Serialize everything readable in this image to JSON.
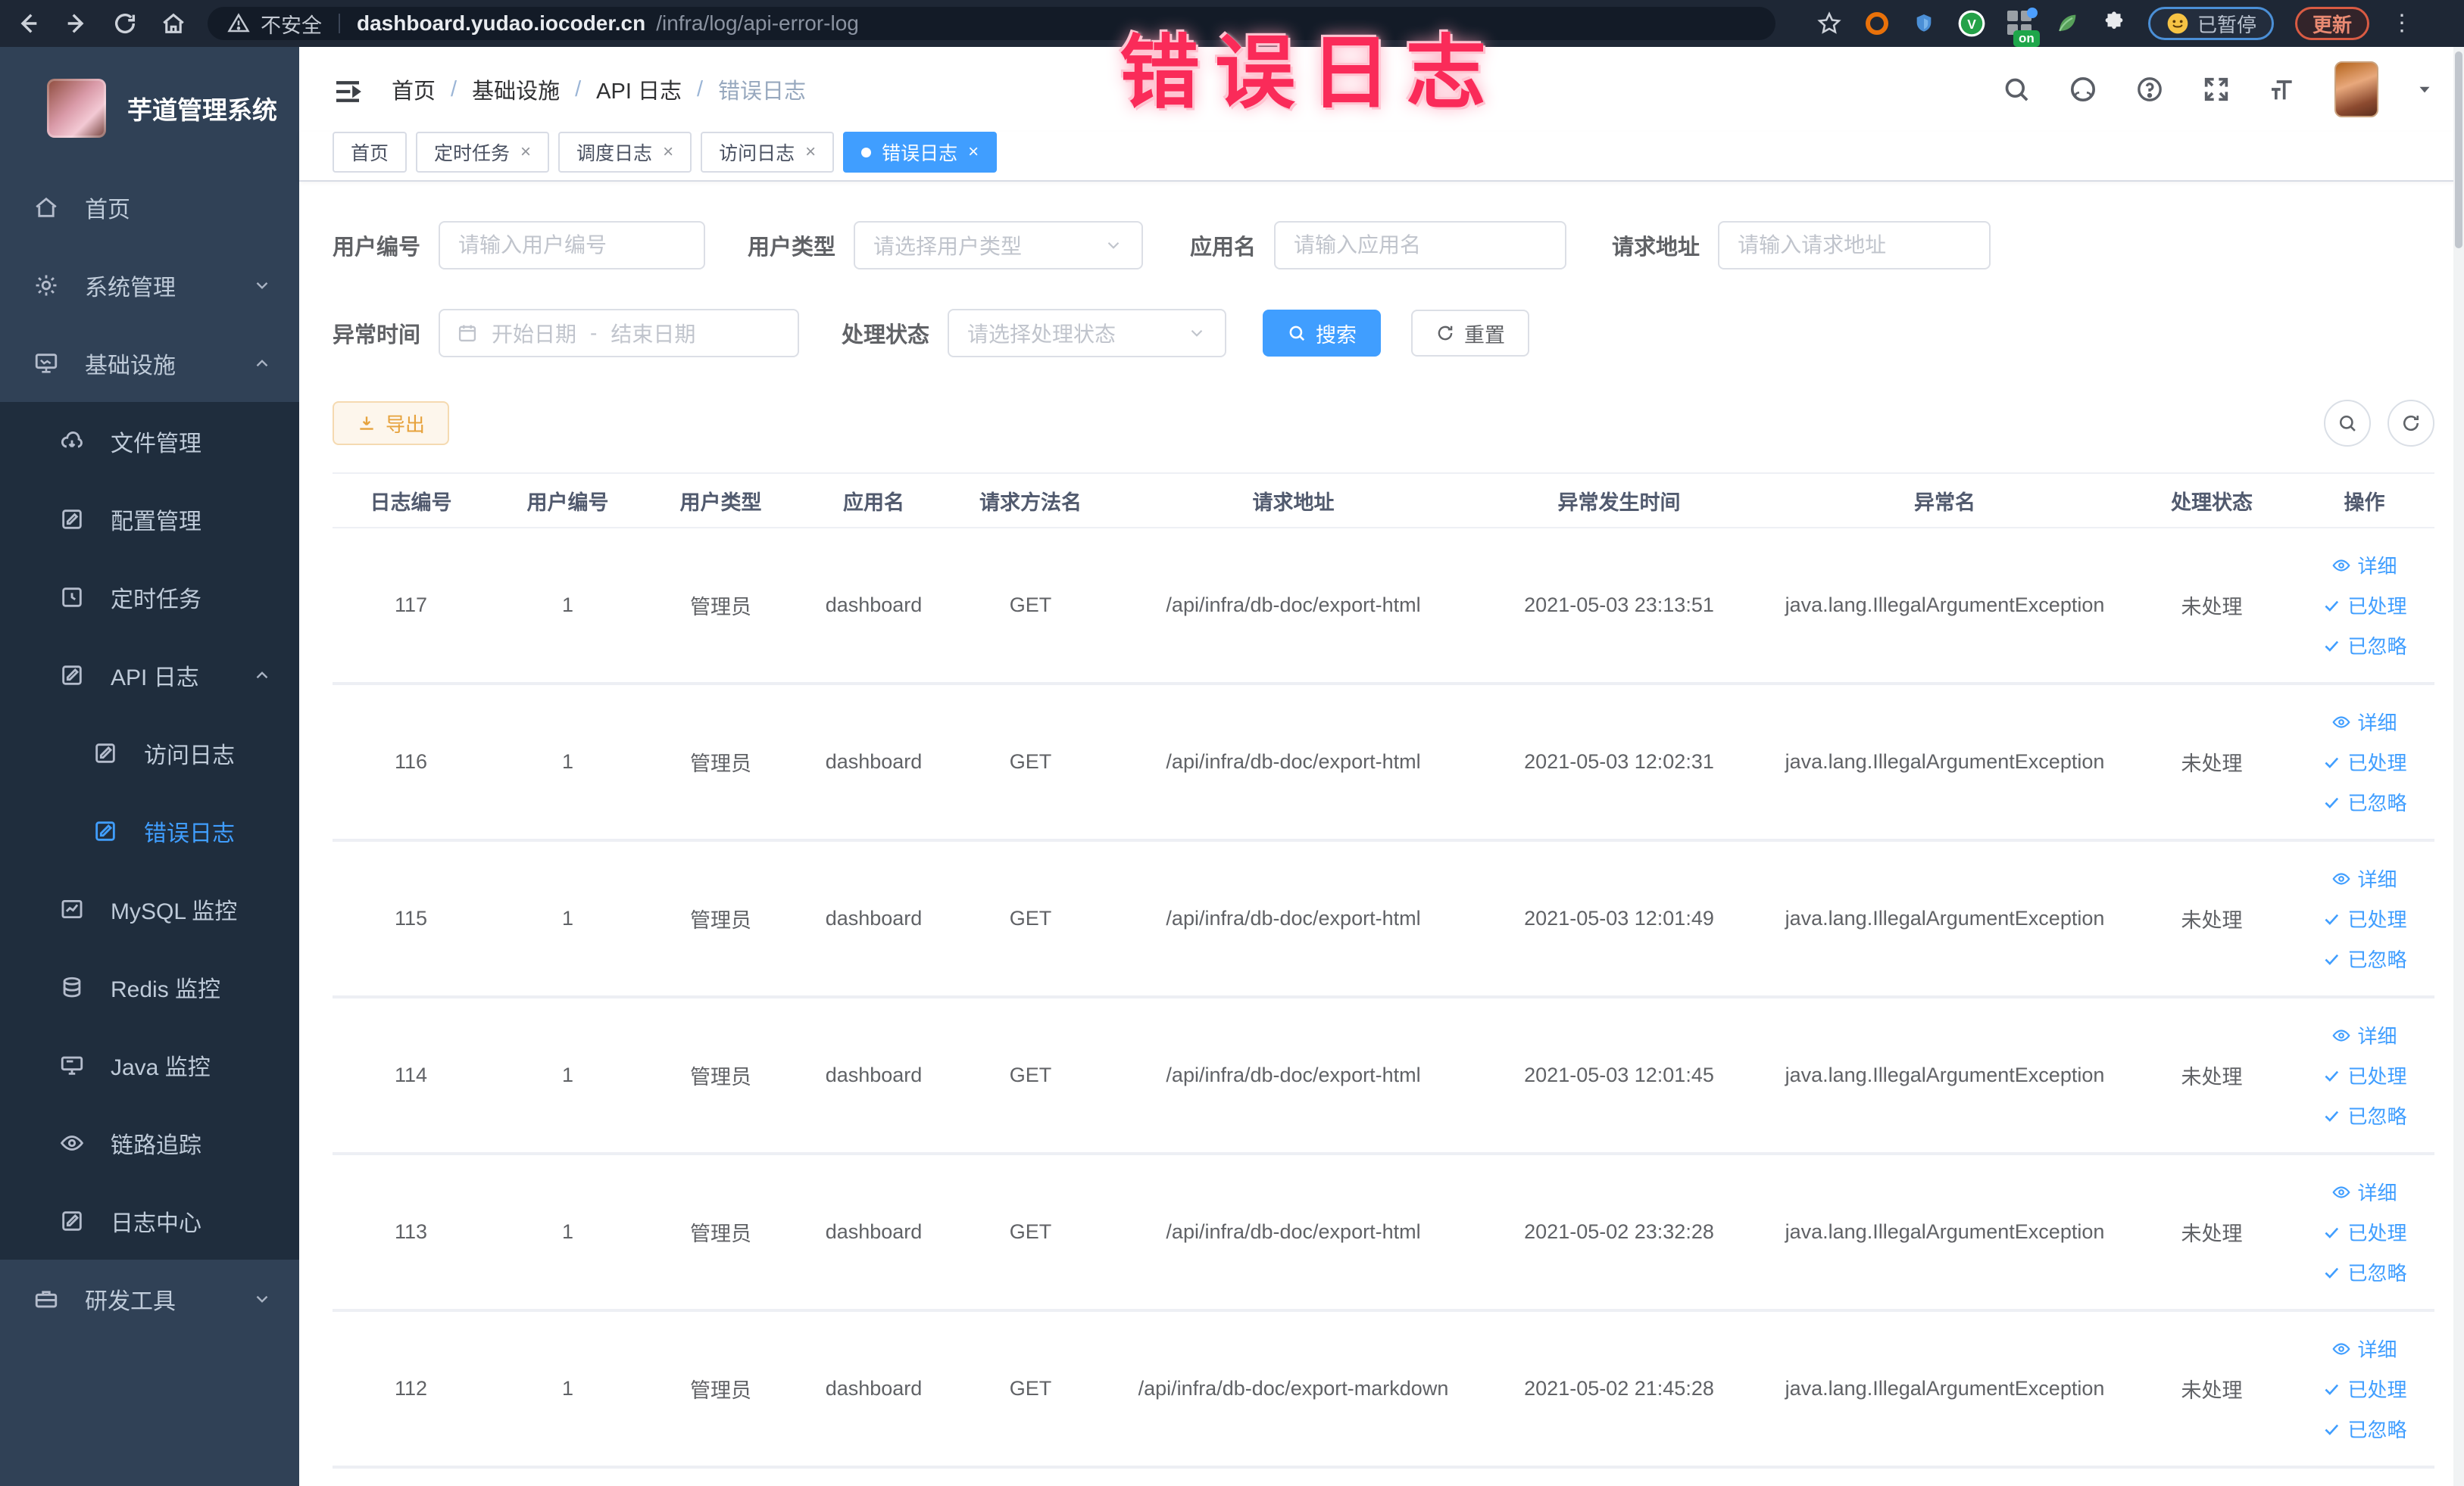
{
  "browser": {
    "security_label": "不安全",
    "url_host": "dashboard.yudao.iocoder.cn",
    "url_path": "/infra/log/api-error-log",
    "ext_badge": "on",
    "ext_v_label": "V",
    "paused_label": "已暂停",
    "update_label": "更新"
  },
  "annotation": {
    "text": "错误日志",
    "color": "#fa2b59"
  },
  "sidebar": {
    "app_title": "芋道管理系统",
    "items": [
      {
        "label": "首页",
        "icon": "home-icon"
      },
      {
        "label": "系统管理",
        "icon": "gear-icon"
      },
      {
        "label": "基础设施",
        "icon": "infra-icon"
      },
      {
        "label": "文件管理",
        "icon": "file-manage-icon"
      },
      {
        "label": "配置管理",
        "icon": "config-manage-icon"
      },
      {
        "label": "定时任务",
        "icon": "scheduled-job-icon"
      },
      {
        "label": "API 日志",
        "icon": "api-log-icon"
      },
      {
        "label": "访问日志",
        "icon": "access-log-icon"
      },
      {
        "label": "错误日志",
        "icon": "error-log-icon"
      },
      {
        "label": "MySQL 监控",
        "icon": "mysql-monitor-icon"
      },
      {
        "label": "Redis 监控",
        "icon": "redis-monitor-icon"
      },
      {
        "label": "Java 监控",
        "icon": "java-monitor-icon"
      },
      {
        "label": "链路追踪",
        "icon": "trace-icon"
      },
      {
        "label": "日志中心",
        "icon": "log-center-icon"
      },
      {
        "label": "研发工具",
        "icon": "devtools-icon"
      }
    ]
  },
  "breadcrumb": {
    "items": [
      "首页",
      "基础设施",
      "API 日志",
      "错误日志"
    ]
  },
  "tabs": [
    {
      "label": "首页"
    },
    {
      "label": "定时任务"
    },
    {
      "label": "调度日志"
    },
    {
      "label": "访问日志"
    },
    {
      "label": "错误日志"
    }
  ],
  "filters": {
    "user_id_label": "用户编号",
    "user_id_placeholder": "请输入用户编号",
    "user_type_label": "用户类型",
    "user_type_placeholder": "请选择用户类型",
    "app_name_label": "应用名",
    "app_name_placeholder": "请输入应用名",
    "request_url_label": "请求地址",
    "request_url_placeholder": "请输入请求地址",
    "exception_time_label": "异常时间",
    "range_start_placeholder": "开始日期",
    "range_separator": "-",
    "range_end_placeholder": "结束日期",
    "process_status_label": "处理状态",
    "process_status_placeholder": "请选择处理状态",
    "search_label": "搜索",
    "reset_label": "重置"
  },
  "toolbar": {
    "export_label": "导出"
  },
  "table": {
    "columns": [
      "日志编号",
      "用户编号",
      "用户类型",
      "应用名",
      "请求方法名",
      "请求地址",
      "异常发生时间",
      "异常名",
      "处理状态",
      "操作"
    ],
    "actions": [
      "详细",
      "已处理",
      "已忽略"
    ],
    "rows": [
      {
        "id": "117",
        "user_id": "1",
        "user_type": "管理员",
        "app": "dashboard",
        "method": "GET",
        "url": "/api/infra/db-doc/export-html",
        "time": "2021-05-03 23:13:51",
        "exception": "java.lang.IllegalArgumentException",
        "status": "未处理"
      },
      {
        "id": "116",
        "user_id": "1",
        "user_type": "管理员",
        "app": "dashboard",
        "method": "GET",
        "url": "/api/infra/db-doc/export-html",
        "time": "2021-05-03 12:02:31",
        "exception": "java.lang.IllegalArgumentException",
        "status": "未处理"
      },
      {
        "id": "115",
        "user_id": "1",
        "user_type": "管理员",
        "app": "dashboard",
        "method": "GET",
        "url": "/api/infra/db-doc/export-html",
        "time": "2021-05-03 12:01:49",
        "exception": "java.lang.IllegalArgumentException",
        "status": "未处理"
      },
      {
        "id": "114",
        "user_id": "1",
        "user_type": "管理员",
        "app": "dashboard",
        "method": "GET",
        "url": "/api/infra/db-doc/export-html",
        "time": "2021-05-03 12:01:45",
        "exception": "java.lang.IllegalArgumentException",
        "status": "未处理"
      },
      {
        "id": "113",
        "user_id": "1",
        "user_type": "管理员",
        "app": "dashboard",
        "method": "GET",
        "url": "/api/infra/db-doc/export-html",
        "time": "2021-05-02 23:32:28",
        "exception": "java.lang.IllegalArgumentException",
        "status": "未处理"
      },
      {
        "id": "112",
        "user_id": "1",
        "user_type": "管理员",
        "app": "dashboard",
        "method": "GET",
        "url": "/api/infra/db-doc/export-markdown",
        "time": "2021-05-02 21:45:28",
        "exception": "java.lang.IllegalArgumentException",
        "status": "未处理"
      }
    ]
  }
}
